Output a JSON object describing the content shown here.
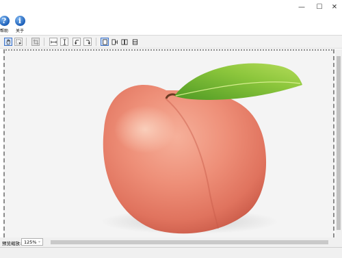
{
  "window": {
    "minimize_glyph": "—",
    "maximize_glyph": "☐",
    "close_glyph": "✕"
  },
  "toolbar": {
    "help_icon_glyph": "?",
    "help_label": "帮助",
    "about_icon_glyph": "i",
    "about_label": "关于"
  },
  "view_toolbar": {
    "icons": [
      "hand-pan-icon",
      "select-region-icon",
      "crop-icon",
      "fit-width-icon",
      "fit-height-icon",
      "rotate-left-icon",
      "rotate-right-icon",
      "single-page-icon",
      "page-with-sidebar-icon",
      "two-pages-icon",
      "page-list-icon"
    ],
    "active": "single-page-icon"
  },
  "preview": {
    "subject": "peach-with-leaf-image"
  },
  "status": {
    "zoom_label": "预览缩放:",
    "zoom_value": "125%",
    "zoom_arrow": "⌄"
  },
  "colors": {
    "accent": "#3a70c8",
    "toolbar_bg": "#f2f2f2"
  }
}
